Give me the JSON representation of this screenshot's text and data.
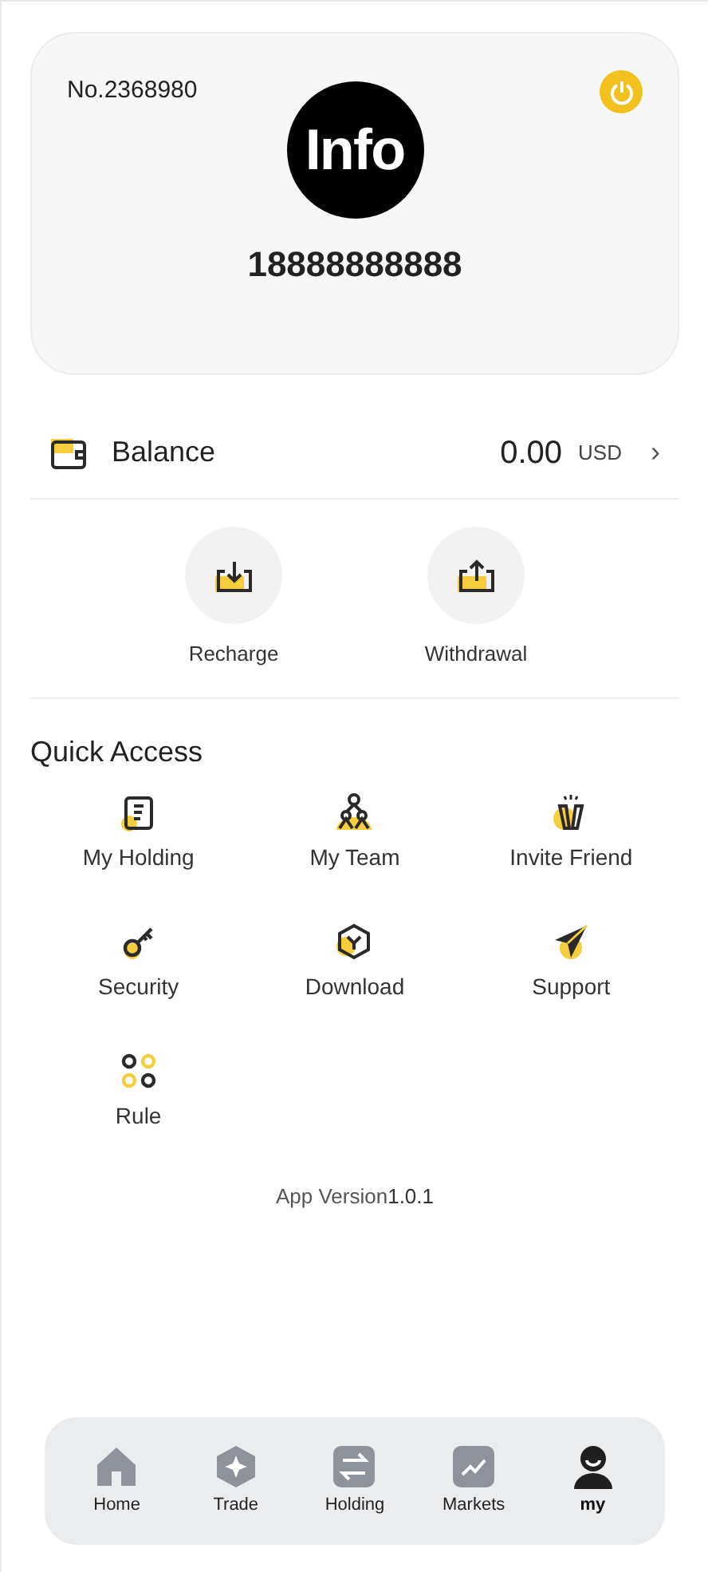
{
  "profile": {
    "number": "No.2368980",
    "avatar_text": "Info",
    "phone": "18888888888"
  },
  "balance": {
    "label": "Balance",
    "amount": "0.00",
    "currency": "USD",
    "chevron": "›"
  },
  "actions": [
    {
      "kind": "recharge",
      "label": "Recharge"
    },
    {
      "kind": "withdrawal",
      "label": "Withdrawal"
    }
  ],
  "quick_access": {
    "title": "Quick Access",
    "items": [
      {
        "kind": "holding",
        "label": "My Holding"
      },
      {
        "kind": "team",
        "label": "My Team"
      },
      {
        "kind": "invite",
        "label": "Invite Friend"
      },
      {
        "kind": "security",
        "label": "Security"
      },
      {
        "kind": "download",
        "label": "Download"
      },
      {
        "kind": "support",
        "label": "Support"
      },
      {
        "kind": "rule",
        "label": "Rule"
      }
    ]
  },
  "version": {
    "label": "App Version",
    "number": "1.0.1"
  },
  "tab_bar": [
    {
      "kind": "home",
      "label": "Home",
      "selected": false
    },
    {
      "kind": "trade",
      "label": "Trade",
      "selected": false
    },
    {
      "kind": "holding",
      "label": "Holding",
      "selected": false
    },
    {
      "kind": "markets",
      "label": "Markets",
      "selected": false
    },
    {
      "kind": "my",
      "label": "my",
      "selected": true
    }
  ]
}
